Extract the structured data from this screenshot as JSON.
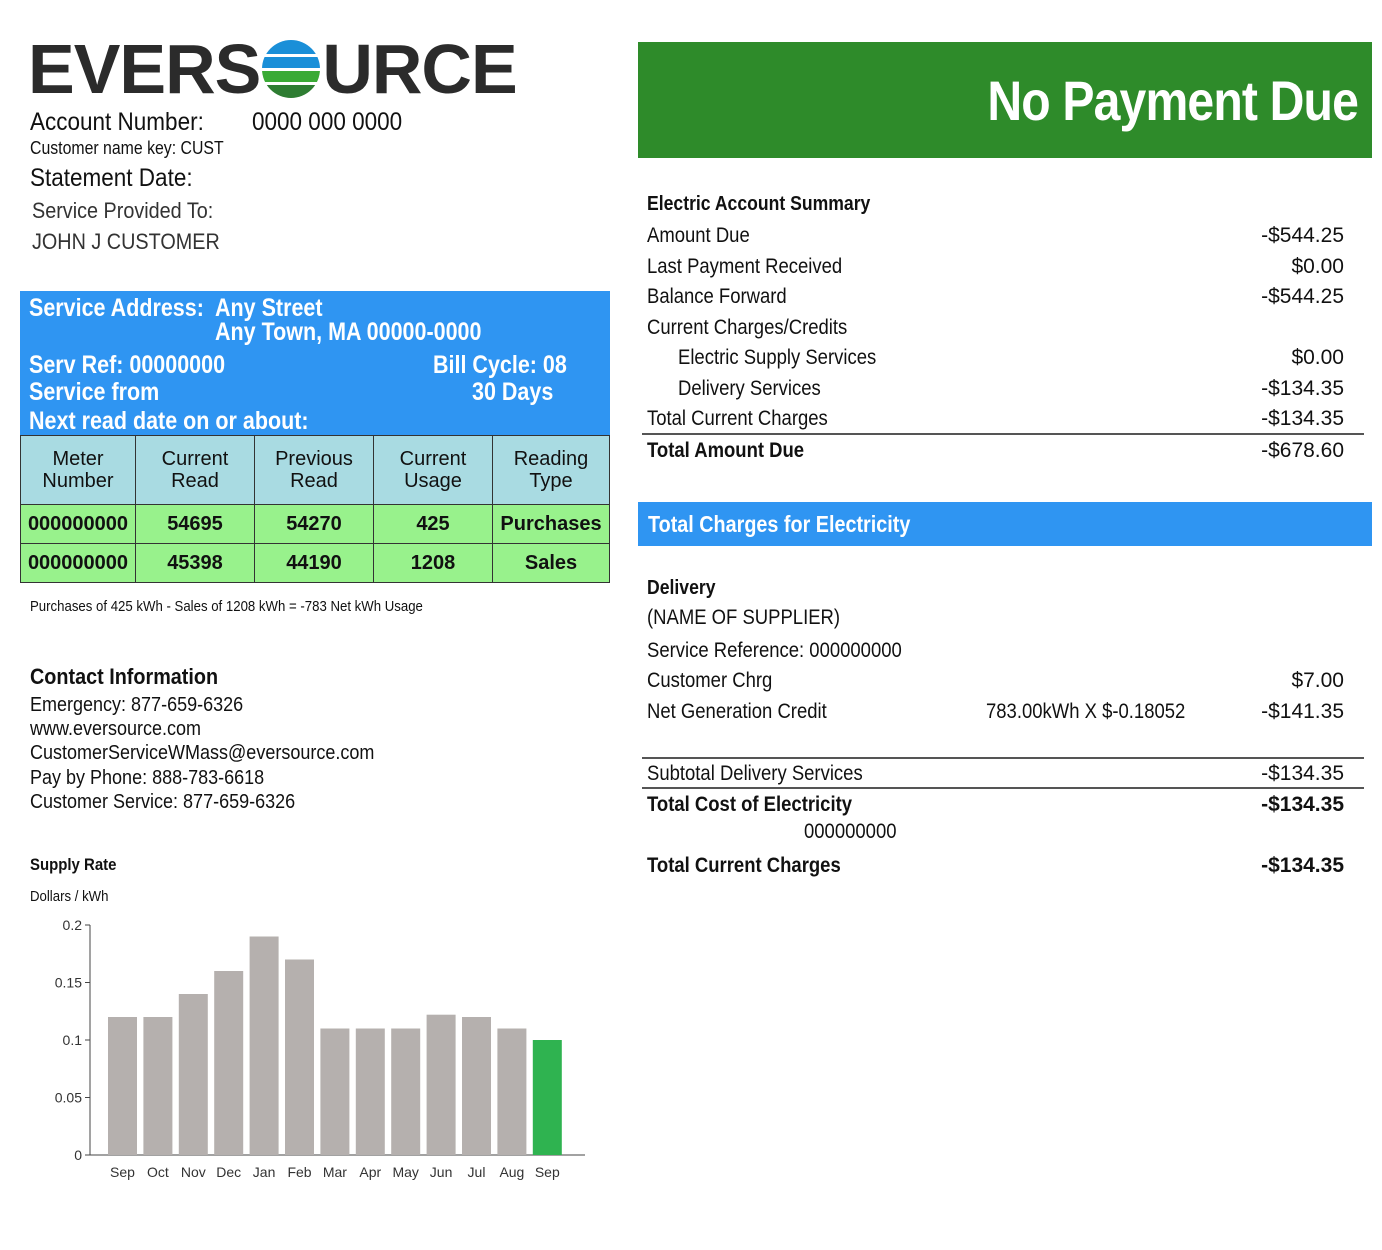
{
  "logo": {
    "left": "EVERS",
    "right": "URCE"
  },
  "account": {
    "number_label": "Account Number:",
    "number_value": "0000 000 0000",
    "name_key": "Customer name key: CUST",
    "statement_label": "Statement Date:",
    "service_to_label": "Service Provided To:",
    "customer_name": "JOHN J CUSTOMER"
  },
  "service_box": {
    "address_label": "Service Address:",
    "address_line1": "Any Street",
    "address_line2": "Any Town, MA 00000-0000",
    "serv_ref": "Serv Ref: 00000000",
    "bill_cycle": "Bill Cycle: 08",
    "service_from": "Service from",
    "days": "30 Days",
    "next_read": "Next read date on or about:"
  },
  "meter_table": {
    "headers": [
      "Meter\nNumber",
      "Current\nRead",
      "Previous\nRead",
      "Current\nUsage",
      "Reading\nType"
    ],
    "rows": [
      [
        "000000000",
        "54695",
        "54270",
        "425",
        "Purchases"
      ],
      [
        "000000000",
        "45398",
        "44190",
        "1208",
        "Sales"
      ]
    ]
  },
  "usage_note": "Purchases of 425 kWh - Sales of 1208 kWh = -783 Net kWh Usage",
  "contact": {
    "title": "Contact Information",
    "lines": [
      "Emergency: 877-659-6326",
      "www.eversource.com",
      "CustomerServiceWMass@eversource.com",
      "Pay by Phone: 888-783-6618",
      "Customer Service: 877-659-6326"
    ]
  },
  "banner": {
    "text": "No Payment Due",
    "color": "#2e8b2a"
  },
  "summary": {
    "title": "Electric Account Summary",
    "rows": [
      {
        "label": "Amount Due",
        "amount": "-$544.25"
      },
      {
        "label": "Last Payment Received",
        "amount": "$0.00"
      },
      {
        "label": "Balance Forward",
        "amount": "-$544.25"
      },
      {
        "label": "Current Charges/Credits",
        "amount": ""
      },
      {
        "label": "Electric Supply Services",
        "amount": "$0.00"
      },
      {
        "label": "Delivery Services",
        "amount": "-$134.35"
      },
      {
        "label": "Total Current Charges",
        "amount": "-$134.35"
      }
    ],
    "total_label": "Total Amount Due",
    "total_amount": "-$678.60"
  },
  "charges": {
    "bar_title": "Total Charges for Electricity",
    "delivery_title": "Delivery",
    "supplier": "(NAME OF SUPPLIER)",
    "service_reference": "Service Reference: 000000000",
    "customer_chrg_label": "Customer Chrg",
    "customer_chrg_amount": "$7.00",
    "net_gen_label": "Net Generation Credit",
    "net_gen_calc": "783.00kWh X $-0.18052",
    "net_gen_amount": "-$141.35",
    "subtotal_label": "Subtotal Delivery Services",
    "subtotal_amount": "-$134.35",
    "total_cost_label": "Total Cost of Electricity",
    "total_cost_amount": "-$134.35",
    "ref_number": "000000000",
    "total_current_label": "Total Current Charges",
    "total_current_amount": "-$134.35"
  },
  "chart_data": {
    "type": "bar",
    "title": "Supply Rate",
    "ylabel": "Dollars / kWh",
    "categories": [
      "Sep",
      "Oct",
      "Nov",
      "Dec",
      "Jan",
      "Feb",
      "Mar",
      "Apr",
      "May",
      "Jun",
      "Jul",
      "Aug",
      "Sep"
    ],
    "values": [
      0.12,
      0.12,
      0.14,
      0.16,
      0.19,
      0.17,
      0.11,
      0.11,
      0.11,
      0.122,
      0.12,
      0.11,
      0.1
    ],
    "ylim": [
      0,
      0.2
    ],
    "yticks": [
      "0",
      "0.05",
      "0.1",
      "0.15",
      "0.2"
    ],
    "colors": {
      "default": "#b5b0ae",
      "current": "#2fb350"
    },
    "highlight_index": 12
  }
}
